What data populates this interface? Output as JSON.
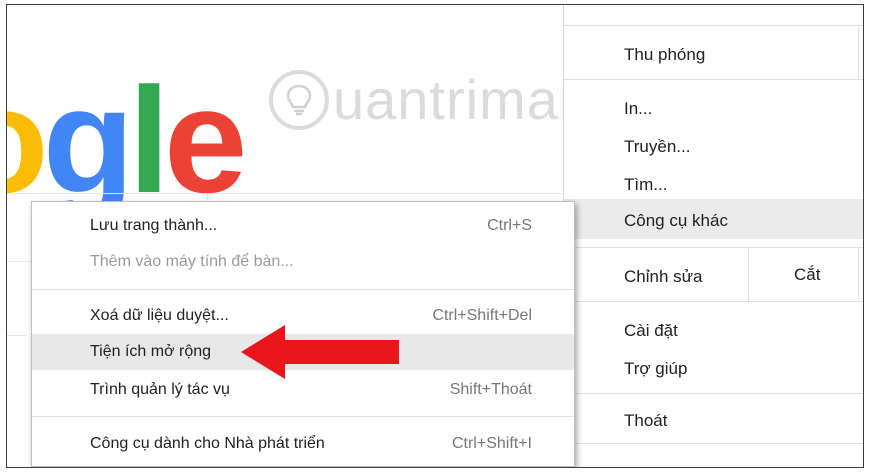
{
  "page": {
    "logo_letters": [
      {
        "ch": "o",
        "color": "#fbbc05"
      },
      {
        "ch": "g",
        "color": "#4285f4"
      },
      {
        "ch": "l",
        "color": "#34a853"
      },
      {
        "ch": "e",
        "color": "#ea4335"
      }
    ]
  },
  "watermark": {
    "text": "uantrimang",
    "icon": "lightbulb-icon"
  },
  "chrome_menu": {
    "zoom_label": "Thu phóng",
    "print_label": "In...",
    "cast_label": "Truyền...",
    "find_label": "Tìm...",
    "more_tools_label": "Công cụ khác",
    "edit_label": "Chỉnh sửa",
    "cut_label": "Cắt",
    "settings_label": "Cài đặt",
    "help_label": "Trợ giúp",
    "exit_label": "Thoát"
  },
  "more_tools_menu": {
    "items": [
      {
        "label": "Lưu trang thành...",
        "shortcut": "Ctrl+S"
      },
      {
        "label": "Thêm vào máy tính để bàn...",
        "shortcut": ""
      },
      {
        "label": "Xoá dữ liệu duyệt...",
        "shortcut": "Ctrl+Shift+Del"
      },
      {
        "label": "Tiện ích mở rộng",
        "shortcut": ""
      },
      {
        "label": "Trình quản lý tác vụ",
        "shortcut": "Shift+Thoát"
      },
      {
        "label": "Công cụ dành cho Nhà phát triển",
        "shortcut": "Ctrl+Shift+I"
      }
    ]
  },
  "colors": {
    "highlight": "#e8e8e8",
    "arrow": "#e8161b"
  }
}
